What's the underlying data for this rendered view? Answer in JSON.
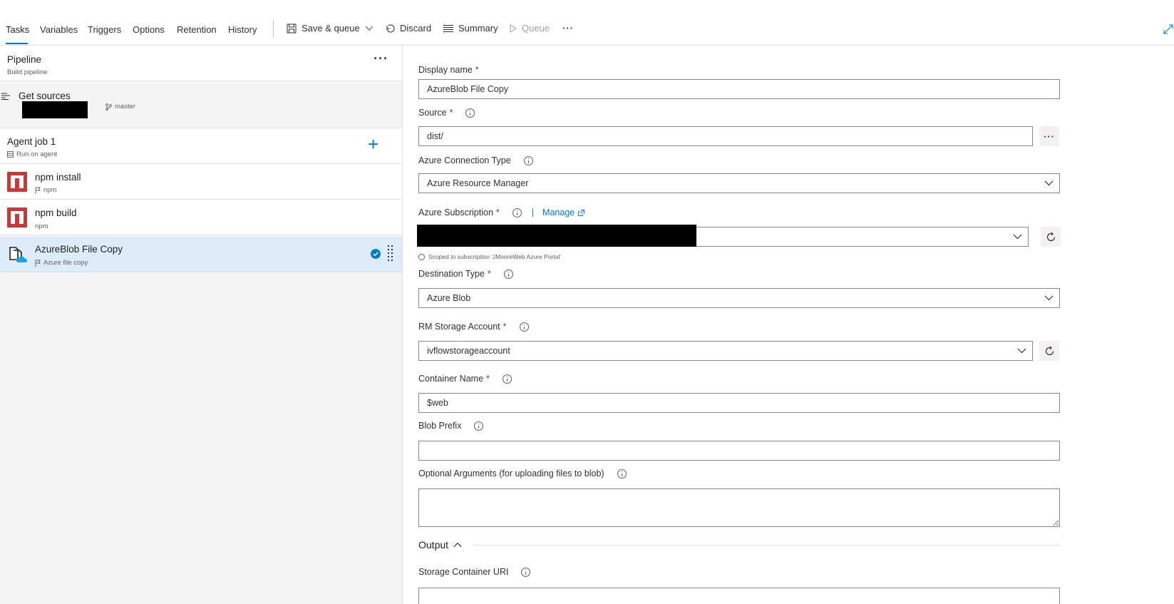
{
  "toolbar": {
    "tabs": [
      "Tasks",
      "Variables",
      "Triggers",
      "Options",
      "Retention",
      "History"
    ],
    "save_queue": "Save & queue",
    "discard": "Discard",
    "summary": "Summary",
    "queue": "Queue",
    "more": "···"
  },
  "pipeline": {
    "title": "Pipeline",
    "subtitle": "Build pipeline",
    "more": "···"
  },
  "get_sources": {
    "title": "Get sources",
    "branch": "master"
  },
  "agent_job": {
    "title": "Agent job 1",
    "subtitle": "Run on agent",
    "add": "+"
  },
  "tasks": [
    {
      "title": "npm install",
      "subtitle": "npm"
    },
    {
      "title": "npm build",
      "subtitle": "npm"
    },
    {
      "title": "AzureBlob File Copy",
      "subtitle": "Azure file copy",
      "selected": true
    }
  ],
  "form": {
    "display_name": {
      "label": "Display name",
      "value": "AzureBlob File Copy"
    },
    "source": {
      "label": "Source",
      "value": "dist/",
      "browse": "···"
    },
    "connection_type": {
      "label": "Azure Connection Type",
      "value": "Azure Resource Manager"
    },
    "subscription": {
      "label": "Azure Subscription",
      "manage": "Manage",
      "hint": "Scoped to subscription 'JMooreWeb Azure Portal'"
    },
    "destination_type": {
      "label": "Destination Type",
      "value": "Azure Blob"
    },
    "storage_account": {
      "label": "RM Storage Account",
      "value": "ivflowstorageaccount"
    },
    "container_name": {
      "label": "Container Name",
      "value": "$web"
    },
    "blob_prefix": {
      "label": "Blob Prefix",
      "value": ""
    },
    "optional_args": {
      "label": "Optional Arguments (for uploading files to blob)",
      "value": ""
    },
    "output": {
      "label": "Output"
    },
    "storage_uri": {
      "label": "Storage Container URI",
      "value": ""
    },
    "required_mark": "*"
  },
  "colors": {
    "accent": "#0078d4",
    "npm_red": "#cb3837",
    "selected_row": "#deecf9",
    "required": "#a4262c"
  }
}
